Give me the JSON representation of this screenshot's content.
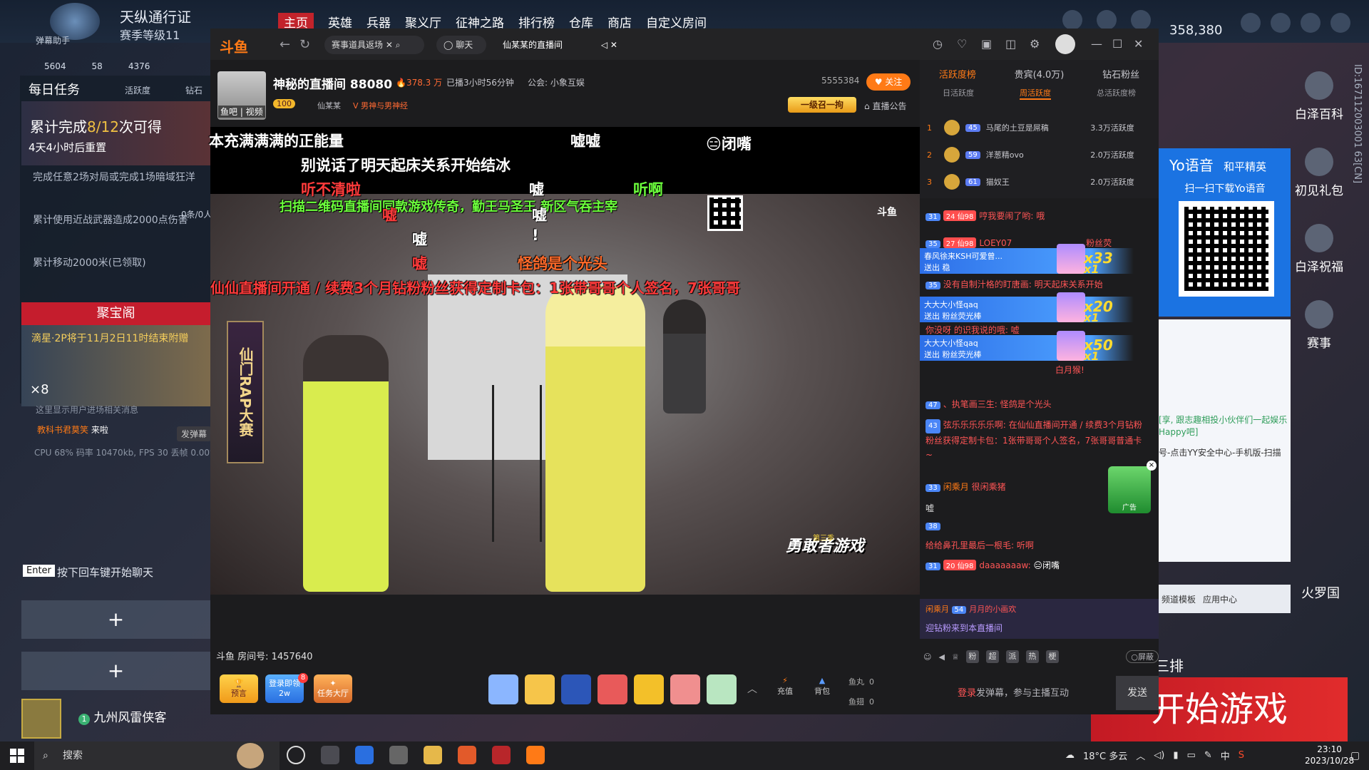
{
  "game": {
    "pass_title": "天纵通行证",
    "pass_level": "赛季等级11",
    "helper": "弹幕助手",
    "tabs": [
      "主页",
      "英雄",
      "兵器",
      "聚义厅",
      "征神之路",
      "排行榜",
      "仓库",
      "商店",
      "自定义房间"
    ],
    "coins": "358,380",
    "stats": [
      "5604",
      "58",
      "4376"
    ],
    "daily_tab": "每日任务",
    "daily_sub": [
      "活跃度",
      "钻石"
    ],
    "task_hero_prefix": "累计完成",
    "task_hero_count": "8/12",
    "task_hero_suffix": "次可得",
    "task_reset": "4天4小时后重置",
    "tasks": [
      "完成任意2场对局或完成1场暗域狂洋",
      "累计使用近战武器造成2000点伤害",
      "累计移动2000米(已领取)"
    ],
    "task_progress": "0条/0人",
    "treasure_title": "聚宝阁",
    "treasure_note": "滴星·2P将于11月2日11时结束附赠",
    "treasure_count": "×8",
    "notice_small": "这里显示用户进场相关消息",
    "notice_user": "教科书君莫笑",
    "notice_user_action": "来啦",
    "send_danmu": "发弹幕",
    "cpu_stats": "CPU 68%  码率 10470kb, FPS 30 丢帧 0.00%",
    "enter_key": "Enter",
    "enter_hint": "按下回车键开始聊天",
    "plus": "+",
    "player_level": "1",
    "player_name": "九州风雷侠客",
    "side_items": [
      "白泽百科",
      "初见礼包",
      "白泽祝福",
      "赛事"
    ],
    "huoluo": "火罗国",
    "sanpai": "三排",
    "start_game": "开始游戏",
    "vertical_id": "ID:167112003001 63[CN]",
    "yo_title": "Yo语音",
    "yo_brand": "和平精英",
    "yo_scan": "扫一扫下载Yo语音",
    "behind_text1": "[享, 跟志趣相投小伙伴们一起娱乐Happy吧]",
    "behind_text2": "号-点击YY安全中心-手机版-扫描",
    "behind_bar": [
      "频道模板",
      "应用中心"
    ]
  },
  "douyu": {
    "logo": "斗鱼",
    "tabs": [
      "赛事道具返场",
      "聊天",
      "仙某某的直播间"
    ],
    "room_title": "神秘的直播间 88080",
    "hot": "378.3 万",
    "live_time": "已播3小时56分钟",
    "guild": "公会: 小象互娱",
    "level_badge": "100",
    "anchor_name": "仙某某",
    "room_tag": "男神与男神经",
    "anchor_tag": "鱼吧 | 视频",
    "follow_count": "5555384",
    "follow_label": "关注",
    "summon": "一级召一拘",
    "notice": "直播公告",
    "room_id_label": "斗鱼 房间号: 1457640",
    "danmu": [
      {
        "text": "本充满满满的正能量",
        "color": "white"
      },
      {
        "text": "嘘嘘",
        "color": "white"
      },
      {
        "text": "😑闭嘴",
        "color": "white"
      },
      {
        "text": "别说话了明天起床关系开始结冰",
        "color": "white"
      },
      {
        "text": "听不清啦",
        "color": "red"
      },
      {
        "text": "嘘",
        "color": "white"
      },
      {
        "text": "听啊",
        "color": "green"
      },
      {
        "text": "扫描二维码直播间同款游戏传奇，勤王马圣王 新区气吞主宰",
        "color": "green"
      },
      {
        "text": "嘘",
        "color": "red"
      },
      {
        "text": "嘘",
        "color": "white"
      },
      {
        "text": "嘘",
        "color": "white"
      },
      {
        "text": "!",
        "color": "white"
      },
      {
        "text": "嘘",
        "color": "red"
      },
      {
        "text": "怪鸽是个光头",
        "color": "orange"
      },
      {
        "text": "仙仙直播间开通 / 续费3个月钻粉粉丝获得定制卡包：1张带哥哥个人签名，7张哥哥",
        "color": "red"
      }
    ],
    "stage_banner": "仙门RAP大赛",
    "show_logo": "勇敢者游戏",
    "show_logo_sub": "第三季",
    "video_watermark": "斗鱼",
    "bottom": {
      "forecast": "预言",
      "login_gift": "登录即领2w",
      "login_badge": "8",
      "task_hall": "任务大厅",
      "recharge": "充值",
      "backpack": "背包",
      "fish_ball_label": "鱼丸",
      "fish_ball_value": "0",
      "fish_fin_label": "鱼翅",
      "fish_fin_value": "0"
    },
    "rank_tabs": [
      "活跃度榜",
      "贵宾(4.0万)",
      "钻石粉丝"
    ],
    "rank_sub": [
      "日活跃度",
      "周活跃度",
      "总活跃度榜"
    ],
    "rank_rows": [
      {
        "n": "1",
        "lv": "45",
        "name": "马尾的土豆是屌稿",
        "score": "3.3万活跃度"
      },
      {
        "n": "2",
        "lv": "59",
        "name": "洋葱精ovo",
        "score": "2.0万活跃度"
      },
      {
        "n": "3",
        "lv": "61",
        "name": "猫奴王",
        "score": "2.0万活跃度"
      }
    ],
    "chat": [
      {
        "lvl": "31",
        "fan": "24 仙98",
        "name": "哼我要闹了哟:",
        "text": "哦"
      },
      {
        "lvl": "35",
        "fan": "27 仙98",
        "name": "LOEY07",
        "text": "粉丝荧"
      },
      {
        "lvl": "35",
        "fan": "",
        "name": "没有自制汁格的盯唐画:",
        "text": "明天起床关系开始"
      },
      {
        "lvl": "47",
        "fan": "",
        "name": "、执笔画三生:",
        "text": "怪鸽是个光头"
      },
      {
        "lvl": "43",
        "fan": "",
        "name": "弦乐乐乐乐乐啊:",
        "text": "在仙仙直播间开通 / 续费3个月钻粉粉丝获得定制卡包：1张带哥哥个人签名，7张哥哥普通卡~"
      },
      {
        "lvl": "33",
        "fan": "",
        "name": "闲乘月",
        "text": "很闲乘猪"
      },
      {
        "lvl": "",
        "fan": "",
        "name": "",
        "text": "嘘"
      },
      {
        "lvl": "38",
        "fan": "",
        "name": "给给鼻孔里最后一根毛:",
        "text": "听啊"
      },
      {
        "lvl": "31",
        "fan": "20 仙98",
        "name": "daaaaaaaw:",
        "text": "😑闭嘴"
      }
    ],
    "gift_banners": [
      {
        "user": "春风徐来KSH可爱曾...",
        "action": "送出 稳",
        "mult1": "x33",
        "mult2": "x1"
      },
      {
        "user": "大大大小怪qaq",
        "action": "送出 粉丝荧光棒",
        "mult1": "x20",
        "mult2": "x1"
      },
      {
        "user": "大大大小怪qaq",
        "action": "送出 粉丝荧光棒",
        "mult1": "x50",
        "mult2": "x1"
      }
    ],
    "gift_partial": "白月猴!",
    "chat_fragment": "你没呀 的识我说的哦: 嘘",
    "ad_label": "广告",
    "welcome_user": "闲乘月",
    "welcome_level": "54",
    "welcome_name2": "月月的小画欢",
    "welcome_text": "迎钻粉来到本直播间",
    "tools": [
      "粉",
      "超",
      "派",
      "热",
      "梗"
    ],
    "shield": "屏蔽",
    "chat_login": "登录",
    "chat_placeholder": "发弹幕，参与主播互动",
    "send": "发送"
  },
  "taskbar": {
    "search": "搜索",
    "weather": "18°C 多云",
    "ime": "中",
    "time": "23:10",
    "date": "2023/10/28"
  }
}
